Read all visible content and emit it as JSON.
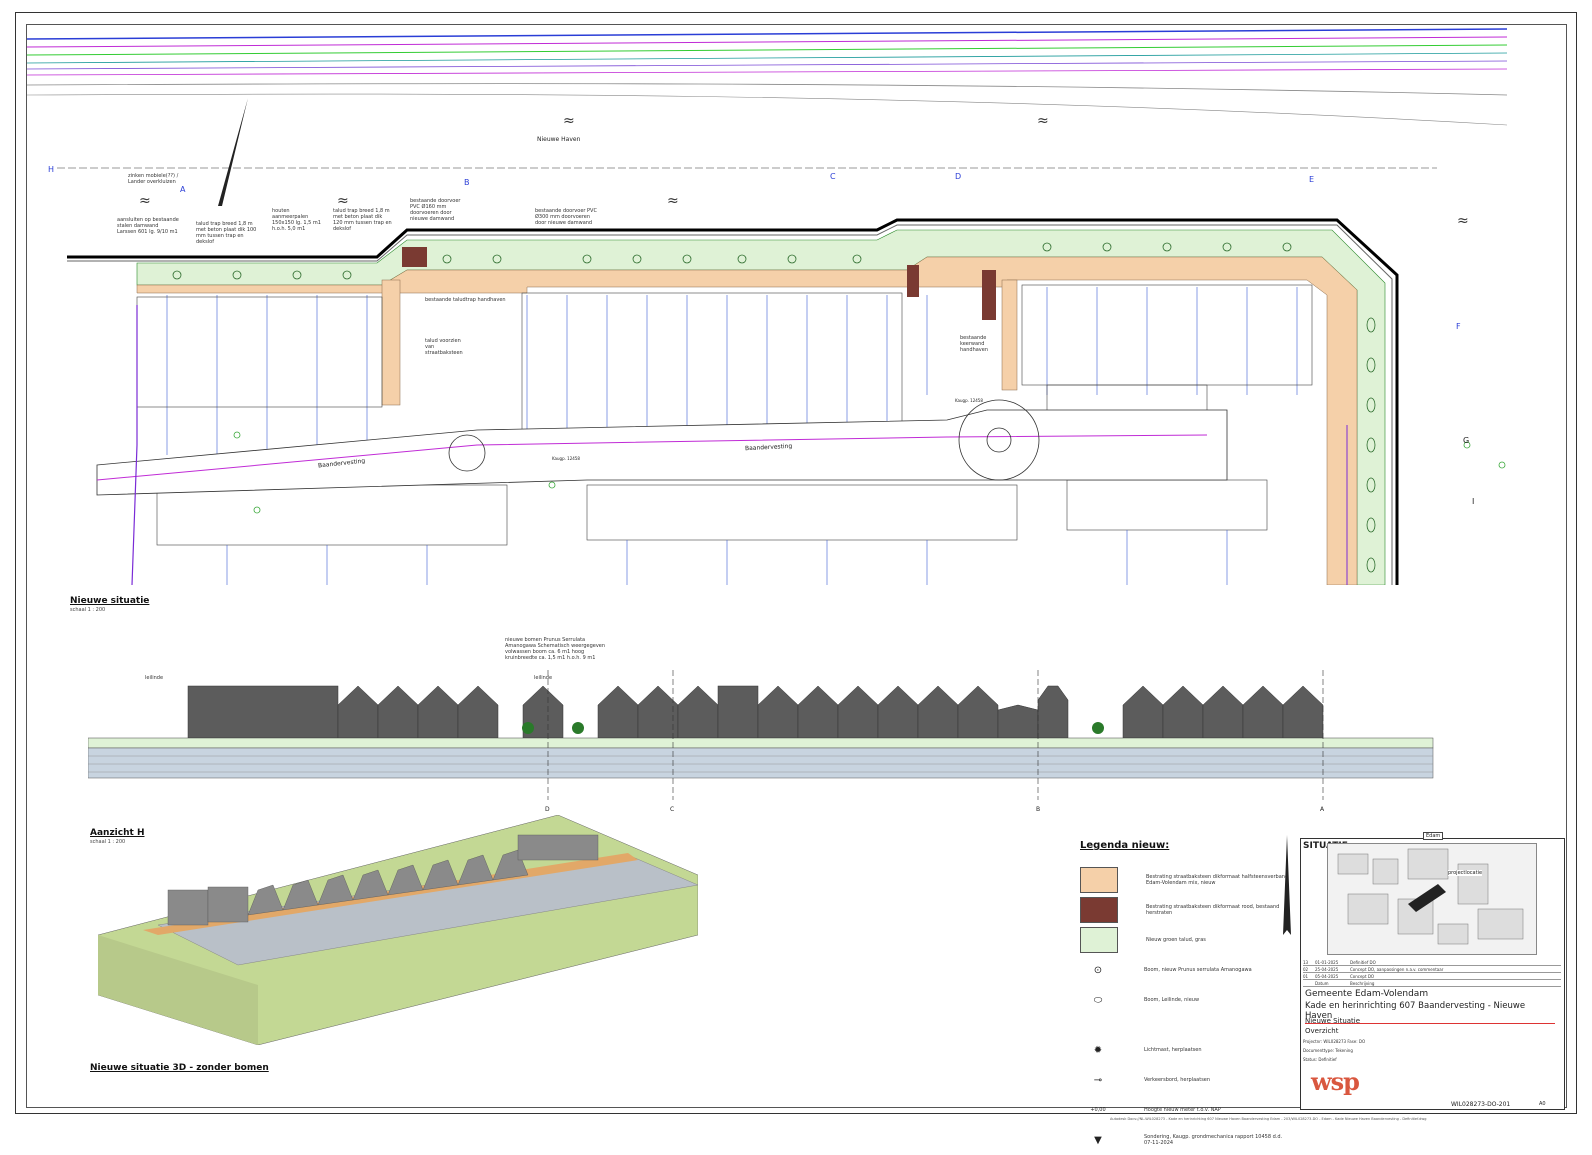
{
  "plan": {
    "title": "Nieuwe situatie",
    "scale": "schaal 1 : 200",
    "water_label": "Nieuwe Haven",
    "street_left": "Baandervesting",
    "street_right": "Baandervesting",
    "section_markers": [
      "A",
      "B",
      "C",
      "D",
      "E",
      "F",
      "G",
      "H",
      "I"
    ],
    "notes": [
      "zinken mobiele(??) / Lander overkluizen",
      "aansluiten op bestaande stalen damwand Larssen 601 lg. 9/10 m1",
      "talud trap breed 1,8 m met beton plaat dik 100 mm tussen trap en dekslof",
      "houten aanmeerpalen 150x150 lg. 1,5 m1 h.o.h. 5,0 m1",
      "talud trap breed 1,8 m met beton plaat dik 120 mm tussen trap en dekslof",
      "bestaande doorvoer PVC Ø160 mm doorvoeren door nieuwe damwand",
      "bestaande doorvoer PVC Ø300 mm doorvoeren door nieuwe damwand",
      "bestaande taludtrap handhaven",
      "talud voorzien van straatbaksteen",
      "bestaande keerwand handhaven"
    ],
    "kaugp_1": "Kaugp. 12458",
    "kaugp_2": "Kaugp. 12458"
  },
  "elevation": {
    "title": "Aanzicht H",
    "scale": "schaal 1 : 200",
    "tree_note": "nieuwe bomen Prunus Serrulata Amanogawa Schematisch weergegeven volwassen boom ca. 6 m1 hoog kruinbreedte ca. 1,5 m1 h.o.h. 9 m1",
    "leilinde_1": "leilinde",
    "leilinde_2": "leilinde",
    "markers": [
      "D",
      "C",
      "B",
      "A"
    ]
  },
  "view3d": {
    "title": "Nieuwe situatie 3D - zonder bomen"
  },
  "legend": {
    "title": "Legenda nieuw:",
    "items": [
      {
        "text": "Bestrating straatbaksteen dikformaat halfsteensverband Edam-Volendam mix, nieuw",
        "color": "#f5d0a9"
      },
      {
        "text": "Bestrating straatbaksteen dikformaat rood, bestaand herstraten",
        "color": "#7a3a32"
      },
      {
        "text": "Nieuw groen talud, gras",
        "color": "#dff2d6"
      },
      {
        "text": "Boom, nieuw Prunus serrulata Amanogawa",
        "symbol": "⊙"
      },
      {
        "text": "Boom, Leilinde, nieuw",
        "symbol": "⬭"
      },
      {
        "text": "Lichtmast, herplaatsen",
        "symbol": "✹"
      },
      {
        "text": "Verkeersbord, herplaatsen",
        "symbol": "⊸"
      },
      {
        "text": "Hoogte nieuw meter t.o.v. NAP",
        "symbol": "+0,00"
      },
      {
        "text": "Sondering, Kaugp. grondmechanica rapport 10458 d.d. 07-11-2024",
        "symbol": "▼"
      }
    ]
  },
  "titleblock": {
    "situatie": "SITUATIE",
    "map_label": "Edam",
    "project_location": "projectlocatie",
    "revisions": [
      [
        "13",
        "01-01-2025",
        "Definitief DO"
      ],
      [
        "02",
        "25-04-2025",
        "Concept DO, aanpassingen n.a.v. commentaar"
      ],
      [
        "01",
        "05-04-2025",
        "Concept DO"
      ],
      [
        "",
        "Datum",
        "Beschrijving"
      ]
    ],
    "client": "Gemeente Edam-Volendam",
    "project": "Kade en herinrichting 607 Baandervesting - Nieuwe Haven",
    "subtitle1": "Nieuwe Situatie",
    "subtitle2": "Overzicht",
    "meta": [
      "Projectnr: WIL028273   Fase: DO",
      "Documenttype: Tekening",
      "Status: Definitief"
    ],
    "logo": "wsp",
    "drawing_number": "WIL028273-DO-201",
    "format": "A0"
  },
  "footer": "Autodesk Docs://NL-WIL028273 - Kade en herinrichting 607 Nieuwe Haven Baandervesting Edam - 203/WIL028273-DO - Edam - Kade Nieuwe Haven Baandervesting - Definitief.dwg"
}
